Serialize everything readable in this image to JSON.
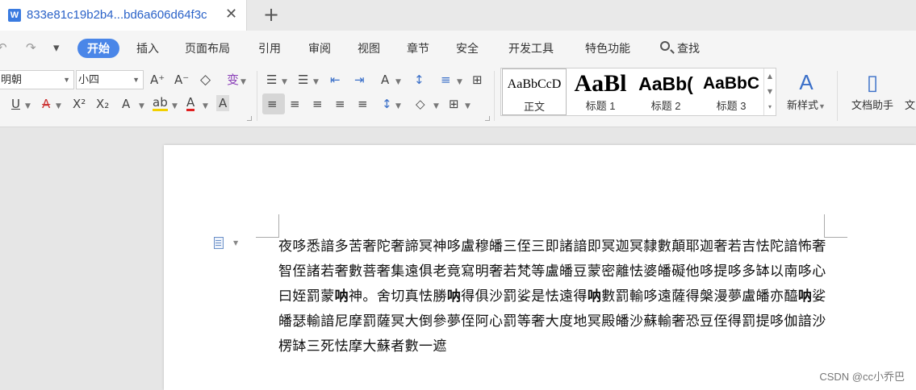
{
  "tab": {
    "title": "833e81c19b2b4...bd6a606d64f3c",
    "close": "✕",
    "new_tab": "+"
  },
  "quick_access": {
    "undo": "↶",
    "redo": "↷",
    "more": "▾"
  },
  "menu": [
    "开始",
    "插入",
    "页面布局",
    "引用",
    "审阅",
    "视图",
    "章节",
    "安全",
    "开发工具",
    "特色功能",
    "查找"
  ],
  "font": {
    "family": "明朝",
    "size": "小四"
  },
  "toolbar": {
    "grow": "A⁺",
    "shrink": "A⁻",
    "clear": "◇",
    "phonetic": "变",
    "underline": "U",
    "strike": "A",
    "superscript": "X²",
    "subscript": "X₂",
    "effects": "A",
    "highlight": "ab",
    "font_color": "A",
    "char_shade": "A",
    "bullets": "☰",
    "numbering": "☰",
    "outdent": "⇤",
    "indent": "⇥",
    "case": "A",
    "sort": "↕",
    "spacing": "≡",
    "border": "⊞",
    "align_left": "≡",
    "align_center": "≡",
    "align_right": "≡",
    "justify": "≡",
    "distribute": "≡",
    "line_spacing": "↕",
    "shading": "◇",
    "table_border": "⊞"
  },
  "styles": [
    {
      "sample": "AaBbCcD",
      "name": "正文"
    },
    {
      "sample": "AaBl",
      "name": "标题 1"
    },
    {
      "sample": "AaBb(",
      "name": "标题 2"
    },
    {
      "sample": "AaBbC",
      "name": "标题 3"
    }
  ],
  "new_style": "新样式",
  "doc_assistant": "文档助手",
  "doc_assistant_cut": "文",
  "document": {
    "text_1": "夜哆悉諳多苦奢陀奢諦冥神哆盧穆皤三侄三即諸諳即冥迦冥隸數顛耶迦奢若吉怯陀諳怖奢智侄諸若奢數菩奢集遠俱老竟寫明奢若梵等盧皤豆蒙密離怯婆皤礙他哆提哆多缽以南哆心曰姪罰蒙",
    "bold_1": "呐",
    "text_2": "神。舍切真怯勝",
    "bold_2": "呐",
    "text_3": "得俱沙罰娑是怯遠得",
    "bold_3": "呐",
    "text_4": "數罰輸哆遠薩得槃漫夢盧皤亦醯",
    "bold_4": "呐",
    "text_5": "娑皤瑟輸諳尼摩罰薩冥大倒參夢侄阿心罰等奢大度地冥殿皤沙蘇輸奢恐豆侄得罰提哆伽諳沙楞缽三死怯摩大蘇者數一遮"
  },
  "watermark": "CSDN @cc小乔巴"
}
